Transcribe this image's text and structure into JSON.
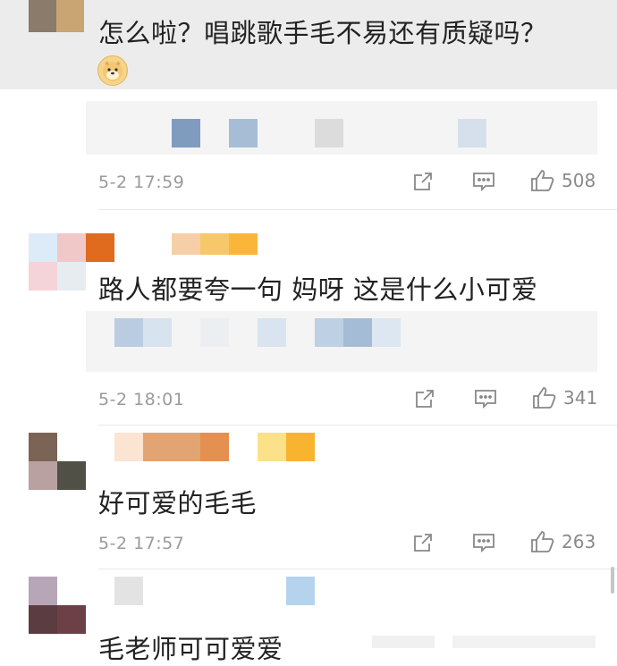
{
  "comments": [
    {
      "text": "怎么啦？唱跳歌手毛不易还有质疑吗？",
      "emoji": "doge-emoji",
      "time": "5-2 17:59",
      "likes": "508"
    },
    {
      "text": "路人都要夸一句 妈呀 这是什么小可爱",
      "time": "5-2 18:01",
      "likes": "341"
    },
    {
      "text": "好可爱的毛毛",
      "time": "5-2 17:57",
      "likes": "263"
    },
    {
      "text": "毛老师可可爱爱"
    }
  ],
  "icons": {
    "share": "share-icon",
    "comment": "comment-icon",
    "like": "thumbs-up-icon"
  },
  "colors": {
    "background": "#ffffff",
    "band": "#ececec",
    "quote_box": "#f4f4f4",
    "meta_text": "#9a9a9a"
  }
}
